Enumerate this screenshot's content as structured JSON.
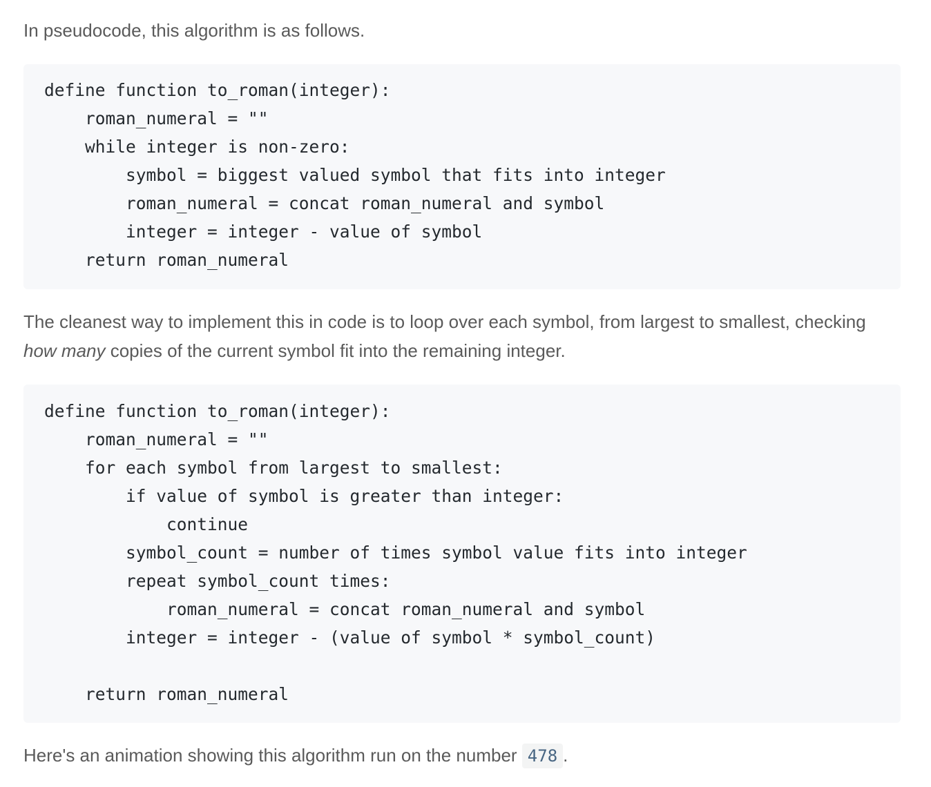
{
  "intro": {
    "text": "In pseudocode, this algorithm is as follows."
  },
  "code_block_1": {
    "lines": [
      "define function to_roman(integer):",
      "    roman_numeral = \"\"",
      "    while integer is non-zero:",
      "        symbol = biggest valued symbol that fits into integer",
      "        roman_numeral = concat roman_numeral and symbol",
      "        integer = integer - value of symbol",
      "    return roman_numeral"
    ]
  },
  "paragraph_2": {
    "part1": "The cleanest way to implement this in code is to loop over each symbol, from largest to smallest, checking ",
    "emphasis": "how many",
    "part2": " copies of the current symbol fit into the remaining integer."
  },
  "code_block_2": {
    "lines": [
      "define function to_roman(integer):",
      "    roman_numeral = \"\"",
      "    for each symbol from largest to smallest:",
      "        if value of symbol is greater than integer:",
      "            continue",
      "        symbol_count = number of times symbol value fits into integer",
      "        repeat symbol_count times:",
      "            roman_numeral = concat roman_numeral and symbol",
      "        integer = integer - (value of symbol * symbol_count)",
      "",
      "    return roman_numeral"
    ]
  },
  "paragraph_3": {
    "part1": "Here's an animation showing this algorithm run on the number ",
    "inline_code": "478",
    "part2": "."
  }
}
